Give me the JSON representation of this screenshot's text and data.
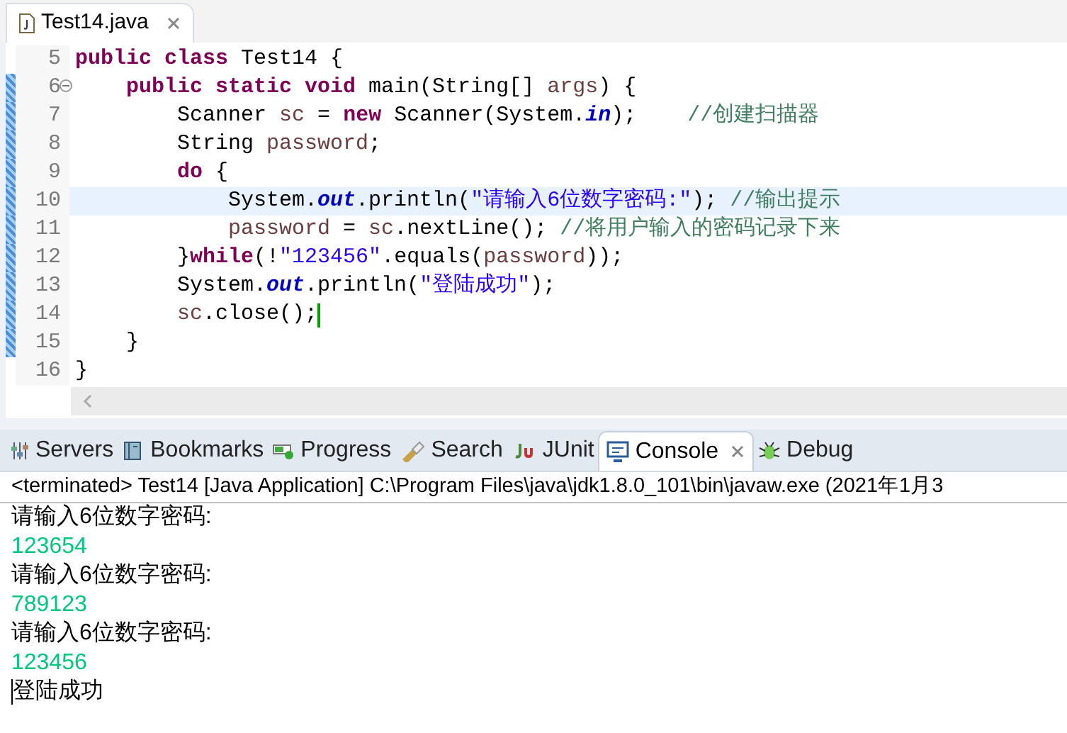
{
  "editor": {
    "tabs": [
      {
        "label": "Test14.java",
        "selected": true
      }
    ],
    "lines": [
      {
        "number": "5",
        "changed": false,
        "fold": false,
        "current": false,
        "caret": false,
        "tokens": [
          {
            "kind": "kw",
            "t": "public class"
          },
          {
            "kind": "plain",
            "t": " Test14 {"
          }
        ]
      },
      {
        "number": "6",
        "changed": true,
        "fold": true,
        "current": false,
        "caret": false,
        "tokens": [
          {
            "kind": "kw",
            "t": "    public static void"
          },
          {
            "kind": "plain",
            "t": " main(String[] "
          },
          {
            "kind": "var",
            "t": "args"
          },
          {
            "kind": "plain",
            "t": ") {"
          }
        ]
      },
      {
        "number": "7",
        "changed": true,
        "fold": false,
        "current": false,
        "caret": false,
        "tokens": [
          {
            "kind": "plain",
            "t": "        Scanner "
          },
          {
            "kind": "var",
            "t": "sc"
          },
          {
            "kind": "plain",
            "t": " = "
          },
          {
            "kind": "kw",
            "t": "new"
          },
          {
            "kind": "plain",
            "t": " Scanner(System."
          },
          {
            "kind": "field",
            "t": "in"
          },
          {
            "kind": "plain",
            "t": ");    "
          },
          {
            "kind": "comment",
            "t": "//创建扫描器"
          }
        ]
      },
      {
        "number": "8",
        "changed": true,
        "fold": false,
        "current": false,
        "caret": false,
        "tokens": [
          {
            "kind": "plain",
            "t": "        String "
          },
          {
            "kind": "var",
            "t": "password"
          },
          {
            "kind": "plain",
            "t": ";"
          }
        ]
      },
      {
        "number": "9",
        "changed": true,
        "fold": false,
        "current": false,
        "caret": false,
        "tokens": [
          {
            "kind": "kw",
            "t": "        do"
          },
          {
            "kind": "plain",
            "t": " {"
          }
        ]
      },
      {
        "number": "10",
        "changed": true,
        "fold": false,
        "current": true,
        "caret": false,
        "tokens": [
          {
            "kind": "plain",
            "t": "            System."
          },
          {
            "kind": "field",
            "t": "out"
          },
          {
            "kind": "plain",
            "t": ".println("
          },
          {
            "kind": "string",
            "t": "\"请输入6位数字密码:\""
          },
          {
            "kind": "plain",
            "t": "); "
          },
          {
            "kind": "comment",
            "t": "//输出提示"
          }
        ]
      },
      {
        "number": "11",
        "changed": true,
        "fold": false,
        "current": false,
        "caret": false,
        "tokens": [
          {
            "kind": "var",
            "t": "            password"
          },
          {
            "kind": "plain",
            "t": " = "
          },
          {
            "kind": "var",
            "t": "sc"
          },
          {
            "kind": "plain",
            "t": ".nextLine(); "
          },
          {
            "kind": "comment",
            "t": "//将用户输入的密码记录下来"
          }
        ]
      },
      {
        "number": "12",
        "changed": true,
        "fold": false,
        "current": false,
        "caret": false,
        "tokens": [
          {
            "kind": "plain",
            "t": "        }"
          },
          {
            "kind": "kw",
            "t": "while"
          },
          {
            "kind": "plain",
            "t": "(!"
          },
          {
            "kind": "string",
            "t": "\"123456\""
          },
          {
            "kind": "plain",
            "t": ".equals("
          },
          {
            "kind": "var",
            "t": "password"
          },
          {
            "kind": "plain",
            "t": "));"
          }
        ]
      },
      {
        "number": "13",
        "changed": true,
        "fold": false,
        "current": false,
        "caret": false,
        "tokens": [
          {
            "kind": "plain",
            "t": "        System."
          },
          {
            "kind": "field",
            "t": "out"
          },
          {
            "kind": "plain",
            "t": ".println("
          },
          {
            "kind": "string",
            "t": "\"登陆成功\""
          },
          {
            "kind": "plain",
            "t": ");"
          }
        ]
      },
      {
        "number": "14",
        "changed": true,
        "fold": false,
        "current": false,
        "caret": true,
        "tokens": [
          {
            "kind": "var",
            "t": "        sc"
          },
          {
            "kind": "plain",
            "t": ".close();"
          }
        ]
      },
      {
        "number": "15",
        "changed": true,
        "fold": false,
        "current": false,
        "caret": false,
        "tokens": [
          {
            "kind": "plain",
            "t": "    }"
          }
        ]
      },
      {
        "number": "16",
        "changed": false,
        "fold": false,
        "current": false,
        "caret": false,
        "tokens": [
          {
            "kind": "plain",
            "t": "}"
          }
        ]
      }
    ]
  },
  "views": {
    "tabs": [
      {
        "label": "Servers",
        "selected": false,
        "closable": false
      },
      {
        "label": "Bookmarks",
        "selected": false,
        "closable": false
      },
      {
        "label": "Progress",
        "selected": false,
        "closable": false
      },
      {
        "label": "Search",
        "selected": false,
        "closable": false
      },
      {
        "label": "JUnit",
        "selected": false,
        "closable": false
      },
      {
        "label": "Console",
        "selected": true,
        "closable": true
      },
      {
        "label": "Debug",
        "selected": false,
        "closable": false
      }
    ],
    "console": {
      "header": "<terminated> Test14 [Java Application] C:\\Program Files\\java\\jdk1.8.0_101\\bin\\javaw.exe  (2021年1月3",
      "lines": [
        {
          "kind": "output",
          "text": "请输入6位数字密码:",
          "caret": false
        },
        {
          "kind": "input",
          "text": "123654",
          "caret": false
        },
        {
          "kind": "output",
          "text": "请输入6位数字密码:",
          "caret": false
        },
        {
          "kind": "input",
          "text": "789123",
          "caret": false
        },
        {
          "kind": "output",
          "text": "请输入6位数字密码:",
          "caret": false
        },
        {
          "kind": "input",
          "text": "123456",
          "caret": false
        },
        {
          "kind": "output",
          "text": "登陆成功",
          "caret": true
        }
      ]
    }
  }
}
